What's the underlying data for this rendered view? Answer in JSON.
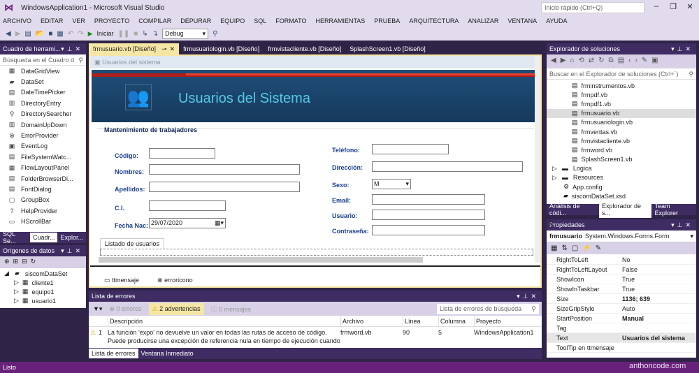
{
  "window": {
    "title": "WindowsApplication1 - Microsoft Visual Studio",
    "quick_launch": "Inicio rápido (Ctrl+Q)"
  },
  "menu": [
    "ARCHIVO",
    "EDITAR",
    "VER",
    "PROYECTO",
    "COMPILAR",
    "DEPURAR",
    "EQUIPO",
    "SQL",
    "FORMATO",
    "HERRAMIENTAS",
    "PRUEBA",
    "ARQUITECTURA",
    "ANALIZAR",
    "VENTANA",
    "AYUDA"
  ],
  "toolbar": {
    "start": "Iniciar",
    "config": "Debug"
  },
  "toolbox": {
    "title": "Cuadro de herrami...",
    "search": "Búsqueda en el Cuadro d",
    "items": [
      "DataGridView",
      "DataSet",
      "DateTimePicker",
      "DirectoryEntry",
      "DirectorySearcher",
      "DomainUpDown",
      "ErrorProvider",
      "EventLog",
      "FileSystemWatc...",
      "FlowLayoutPanel",
      "FolderBrowserDi...",
      "FontDialog",
      "GroupBox",
      "HelpProvider",
      "HScrollBar"
    ],
    "tabs": [
      "SQL Se...",
      "Cuadr...",
      "Explor..."
    ]
  },
  "datasources": {
    "title": "Orígenes de datos",
    "root": "siscomDataSet",
    "children": [
      "cliente1",
      "equipo1",
      "usuario1"
    ]
  },
  "doc_tabs": [
    "frmusuario.vb [Diseño]",
    "frmusuariologin.vb [Diseño]",
    "frmvistacliente.vb [Diseño]",
    "SplashScreen1.vb [Diseño]"
  ],
  "form": {
    "caption": "Usuarios del sistema",
    "banner": "Usuarios del Sistema",
    "group": "Mantenimiento de trabajadores",
    "left_fields": [
      {
        "label": "Código:",
        "value": ""
      },
      {
        "label": "Nombres:",
        "value": ""
      },
      {
        "label": "Apellidos:",
        "value": ""
      },
      {
        "label": "C.I.",
        "value": ""
      },
      {
        "label": "Fecha Nac:",
        "value": "29/07/2020"
      }
    ],
    "right_fields": [
      {
        "label": "Teléfono:",
        "value": ""
      },
      {
        "label": "Dirección:",
        "value": ""
      },
      {
        "label": "Sexo:",
        "value": "M"
      },
      {
        "label": "Email:",
        "value": ""
      },
      {
        "label": "Usuario:",
        "value": ""
      },
      {
        "label": "Contraseña:",
        "value": ""
      }
    ],
    "tab": "Listado de usuarios",
    "tray": [
      "ttmensaje",
      "erroricono"
    ]
  },
  "errors": {
    "title": "Lista de errores",
    "errors": "0 errores",
    "warnings": "2 advertencias",
    "messages": "0 mensajes",
    "search": "Lista de errores de búsqueda",
    "columns": [
      "Descripción",
      "Archivo",
      "Línea",
      "Columna",
      "Proyecto"
    ],
    "rows": [
      {
        "n": "1",
        "desc": "La función 'expo' no devuelve un valor en todas las rutas de acceso de código.",
        "desc2": "Puede producirse una excepción de referencia nula en tiempo de ejecución cuando",
        "file": "frmword.vb",
        "line": "90",
        "col": "5",
        "project": "WindowsApplication1"
      }
    ],
    "tabs": [
      "Lista de errores",
      "Ventana Inmediato"
    ]
  },
  "solution": {
    "title": "Explorador de soluciones",
    "search": "Buscar en el Explorador de soluciones (Ctrl+´)",
    "files": [
      "frminstrumentos.vb",
      "frmpdf.vb",
      "frmpdf1.vb",
      "frmusuario.vb",
      "frmusuariologin.vb",
      "frmventas.vb",
      "frmvistacliente.vb",
      "frmword.vb",
      "SplashScreen1.vb"
    ],
    "folders": [
      "Logica",
      "Resources"
    ],
    "others": [
      "App.config",
      "siscomDataSet.xsd"
    ],
    "tabs": [
      "Análisis de códi...",
      "Explorador de s...",
      "Team Explorer"
    ]
  },
  "properties": {
    "title": "Propiedades",
    "object": "frmusuario",
    "type": "System.Windows.Forms.Form",
    "rows": [
      {
        "n": "RightToLeft",
        "v": "No"
      },
      {
        "n": "RightToLeftLayout",
        "v": "False"
      },
      {
        "n": "ShowIcon",
        "v": "True"
      },
      {
        "n": "ShowInTaskbar",
        "v": "True"
      },
      {
        "n": "Size",
        "v": "1136; 639",
        "bold": true
      },
      {
        "n": "SizeGripStyle",
        "v": "Auto"
      },
      {
        "n": "StartPosition",
        "v": "Manual",
        "bold": true
      },
      {
        "n": "Tag",
        "v": ""
      },
      {
        "n": "Text",
        "v": "Usuarios del sistema",
        "bold": true
      },
      {
        "n": "ToolTip en ttmensaje",
        "v": ""
      }
    ]
  },
  "status": "Listo",
  "watermark": "anthoncode.com"
}
